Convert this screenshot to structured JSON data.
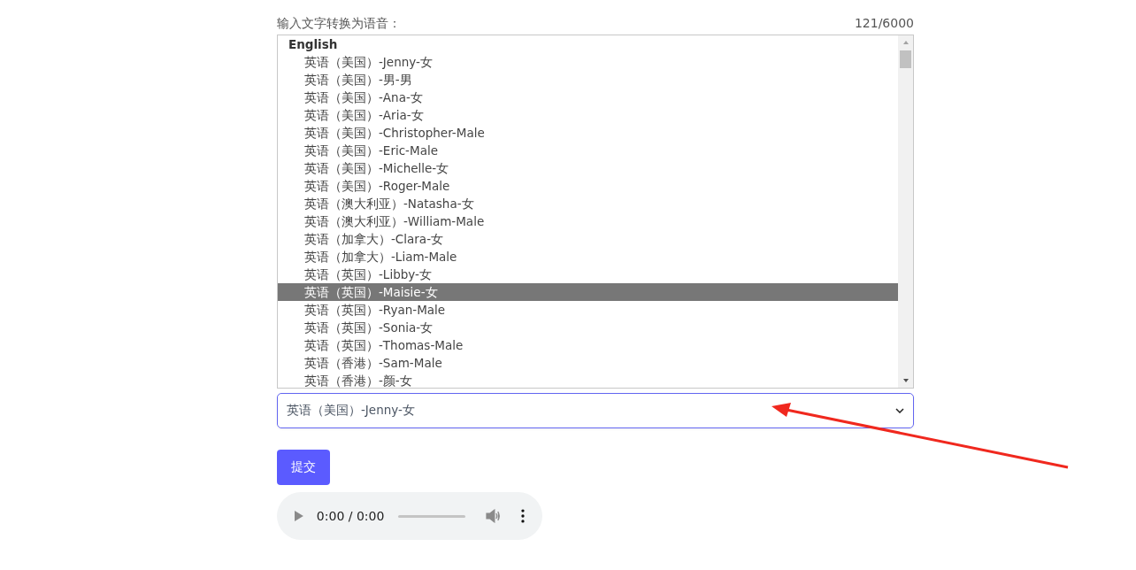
{
  "form": {
    "label": "输入文字转换为语音：",
    "counter": "121/6000"
  },
  "dropdown": {
    "group": "English",
    "options": [
      {
        "label": "英语（美国）-Jenny-女",
        "selected": false
      },
      {
        "label": "英语（美国）-男-男",
        "selected": false
      },
      {
        "label": "英语（美国）-Ana-女",
        "selected": false
      },
      {
        "label": "英语（美国）-Aria-女",
        "selected": false
      },
      {
        "label": "英语（美国）-Christopher-Male",
        "selected": false
      },
      {
        "label": "英语（美国）-Eric-Male",
        "selected": false
      },
      {
        "label": "英语（美国）-Michelle-女",
        "selected": false
      },
      {
        "label": "英语（美国）-Roger-Male",
        "selected": false
      },
      {
        "label": "英语（澳大利亚）-Natasha-女",
        "selected": false
      },
      {
        "label": "英语（澳大利亚）-William-Male",
        "selected": false
      },
      {
        "label": "英语（加拿大）-Clara-女",
        "selected": false
      },
      {
        "label": "英语（加拿大）-Liam-Male",
        "selected": false
      },
      {
        "label": "英语（英国）-Libby-女",
        "selected": false
      },
      {
        "label": "英语（英国）-Maisie-女",
        "selected": true
      },
      {
        "label": "英语（英国）-Ryan-Male",
        "selected": false
      },
      {
        "label": "英语（英国）-Sonia-女",
        "selected": false
      },
      {
        "label": "英语（英国）-Thomas-Male",
        "selected": false
      },
      {
        "label": "英语（香港）-Sam-Male",
        "selected": false
      },
      {
        "label": "英语（香港）-颜-女",
        "selected": false
      }
    ]
  },
  "select": {
    "value": "英语（美国）-Jenny-女"
  },
  "submit_button": "提交",
  "audio": {
    "time": "0:00 / 0:00"
  }
}
